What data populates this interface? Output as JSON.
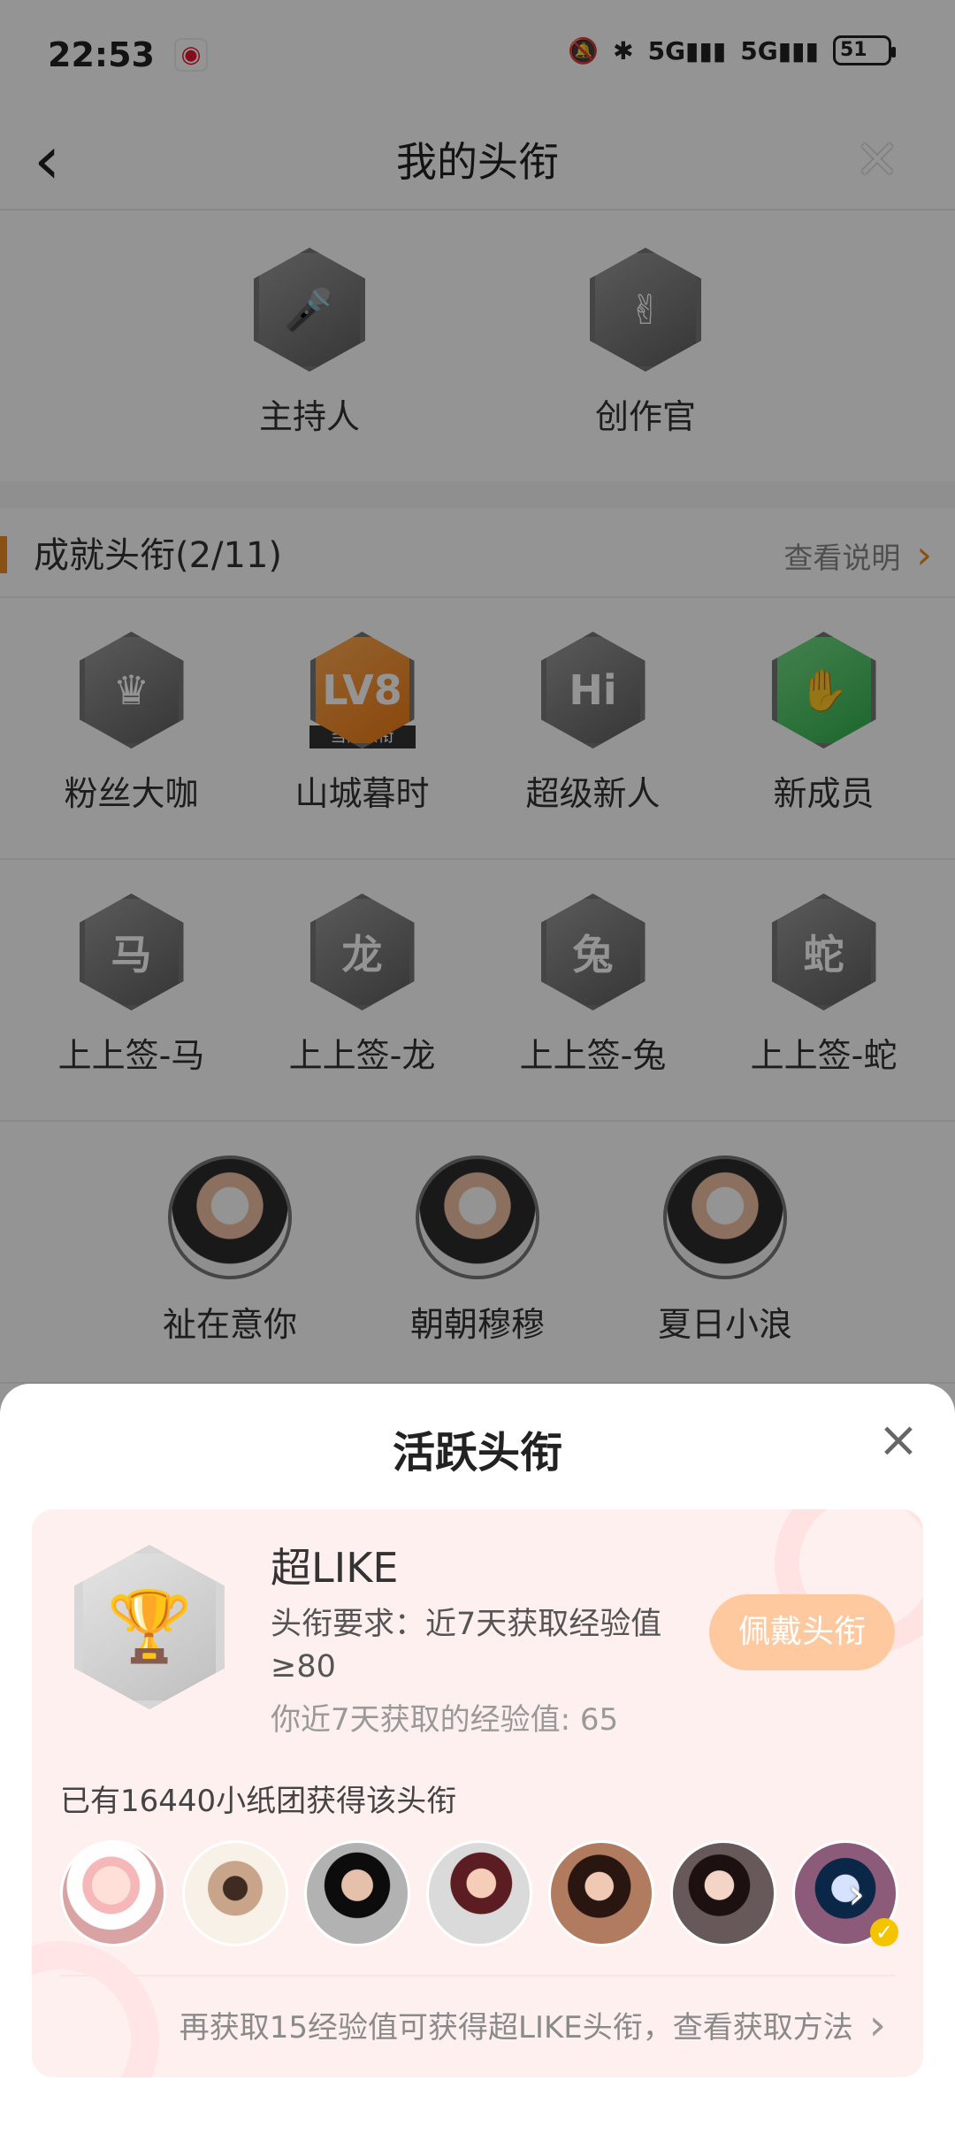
{
  "status_bar": {
    "time": "22:53",
    "battery": "51"
  },
  "header": {
    "back_icon": "back-arrow-icon",
    "title": "我的头衔",
    "close_icon": "close-icon"
  },
  "special_titles": [
    {
      "label": "主持人",
      "badge_text": "🎤"
    },
    {
      "label": "创作官",
      "badge_text": "✌"
    }
  ],
  "achievement": {
    "title": "成就头衔(2/11)",
    "info_link": "查看说明",
    "rows": [
      [
        {
          "label": "粉丝大咖",
          "badge_text": "♛"
        },
        {
          "label": "山城暮时",
          "badge_text": "LV8",
          "tag": "当前头衔"
        },
        {
          "label": "超级新人",
          "badge_text": "Hi"
        },
        {
          "label": "新成员",
          "badge_text": "✋"
        }
      ],
      [
        {
          "label": "上上签-马",
          "badge_text": "马"
        },
        {
          "label": "上上签-龙",
          "badge_text": "龙"
        },
        {
          "label": "上上签-兔",
          "badge_text": "兔"
        },
        {
          "label": "上上签-蛇",
          "badge_text": "蛇"
        }
      ],
      [
        {
          "label": "祉在意你"
        },
        {
          "label": "朝朝穆穆"
        },
        {
          "label": "夏日小浪"
        }
      ]
    ]
  },
  "sheet": {
    "title": "活跃头衔",
    "close_icon": "close-icon",
    "item": {
      "name": "超LIKE",
      "requirement": "头衔要求：近7天获取经验值≥80",
      "experience": "你近7天获取的经验值: 65",
      "button": "佩戴头衔",
      "owners_count": "已有16440小纸团获得该头衔",
      "hint": "再获取15经验值可获得超LIKE头衔，查看获取方法"
    }
  }
}
